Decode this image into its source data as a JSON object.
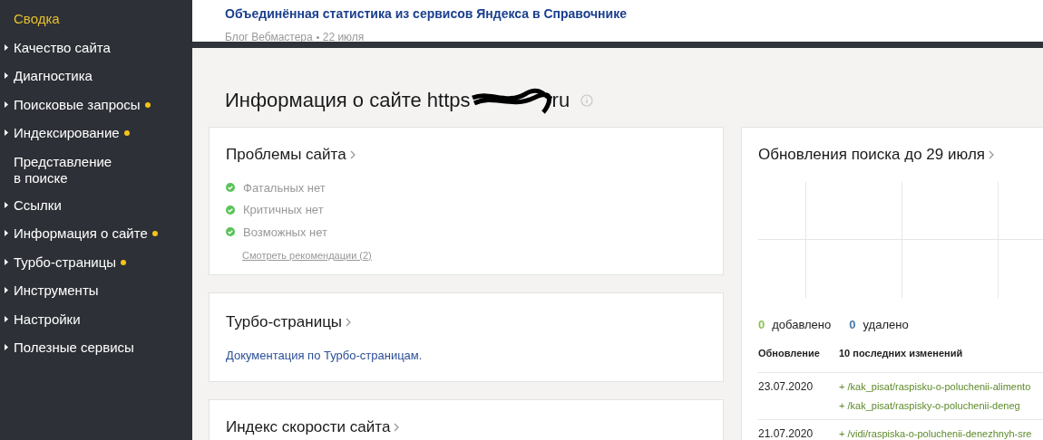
{
  "sidebar": {
    "items": [
      {
        "label": "Сводка",
        "selected": true,
        "expandable": false,
        "dot": false
      },
      {
        "label": "Качество сайта",
        "selected": false,
        "expandable": true,
        "dot": false
      },
      {
        "label": "Диагностика",
        "selected": false,
        "expandable": true,
        "dot": false
      },
      {
        "label": "Поисковые запросы",
        "selected": false,
        "expandable": true,
        "dot": true
      },
      {
        "label": "Индексирование",
        "selected": false,
        "expandable": true,
        "dot": true
      },
      {
        "label": "Представление в поиске",
        "selected": false,
        "expandable": false,
        "dot": false
      },
      {
        "label": "Ссылки",
        "selected": false,
        "expandable": true,
        "dot": false
      },
      {
        "label": "Информация о сайте",
        "selected": false,
        "expandable": true,
        "dot": true
      },
      {
        "label": "Турбо-страницы",
        "selected": false,
        "expandable": true,
        "dot": true
      },
      {
        "label": "Инструменты",
        "selected": false,
        "expandable": true,
        "dot": false
      },
      {
        "label": "Настройки",
        "selected": false,
        "expandable": true,
        "dot": false
      },
      {
        "label": "Полезные сервисы",
        "selected": false,
        "expandable": true,
        "dot": false
      }
    ]
  },
  "news": {
    "title": "Объединённая статистика из сервисов Яндекса в Справочнике",
    "source": "Блог Вебмастера",
    "date": "22 июля"
  },
  "page_title": {
    "start": "Информация о сайте https",
    "end": "ru"
  },
  "problems": {
    "title": "Проблемы сайта",
    "items": [
      "Фатальных нет",
      "Критичных нет",
      "Возможных нет"
    ],
    "link": "Смотреть рекомендации (2)"
  },
  "turbo": {
    "title": "Турбо-страницы",
    "link": "Документация по Турбо-страницам."
  },
  "speed": {
    "title": "Индекс скорости сайта"
  },
  "updates": {
    "title": "Обновления поиска до 29 июля",
    "added_count": "0",
    "added_label": "добавлено",
    "removed_count": "0",
    "removed_label": "удалено",
    "columns": [
      "Обновление",
      "10 последних изменений"
    ],
    "rows": [
      {
        "date": "23.07.2020",
        "changes": [
          "+ /kak_pisat/raspisku-o-poluchenii-alimento",
          "+ /kak_pisat/raspisky-o-poluchenii-deneg"
        ]
      },
      {
        "date": "21.07.2020",
        "changes": [
          "+ /vidi/raspiska-o-poluchenii-denezhnyh-sre"
        ]
      }
    ]
  }
}
